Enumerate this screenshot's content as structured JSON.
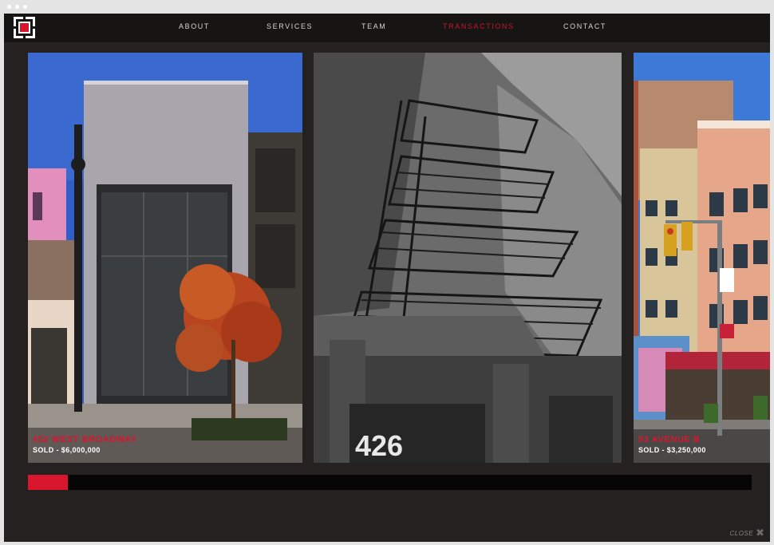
{
  "nav": {
    "items": [
      {
        "label": "ABOUT"
      },
      {
        "label": "SERVICES"
      },
      {
        "label": "TEAM"
      },
      {
        "label": "TRANSACTIONS"
      },
      {
        "label": "CONTACT"
      }
    ],
    "active_index": 3
  },
  "slides": [
    {
      "title": "452 WEST BROADWAY",
      "status": "SOLD - $6,000,000"
    },
    {
      "address_number": "426"
    },
    {
      "title": "93 AVENUE B",
      "status": "SOLD - $3,250,000"
    }
  ],
  "progress": {
    "fraction": 0.055
  },
  "close": {
    "label": "CLOSE",
    "icon": "close-x-icon"
  },
  "colors": {
    "accent": "#d8172f",
    "background": "#242120",
    "nav": "#171514"
  }
}
